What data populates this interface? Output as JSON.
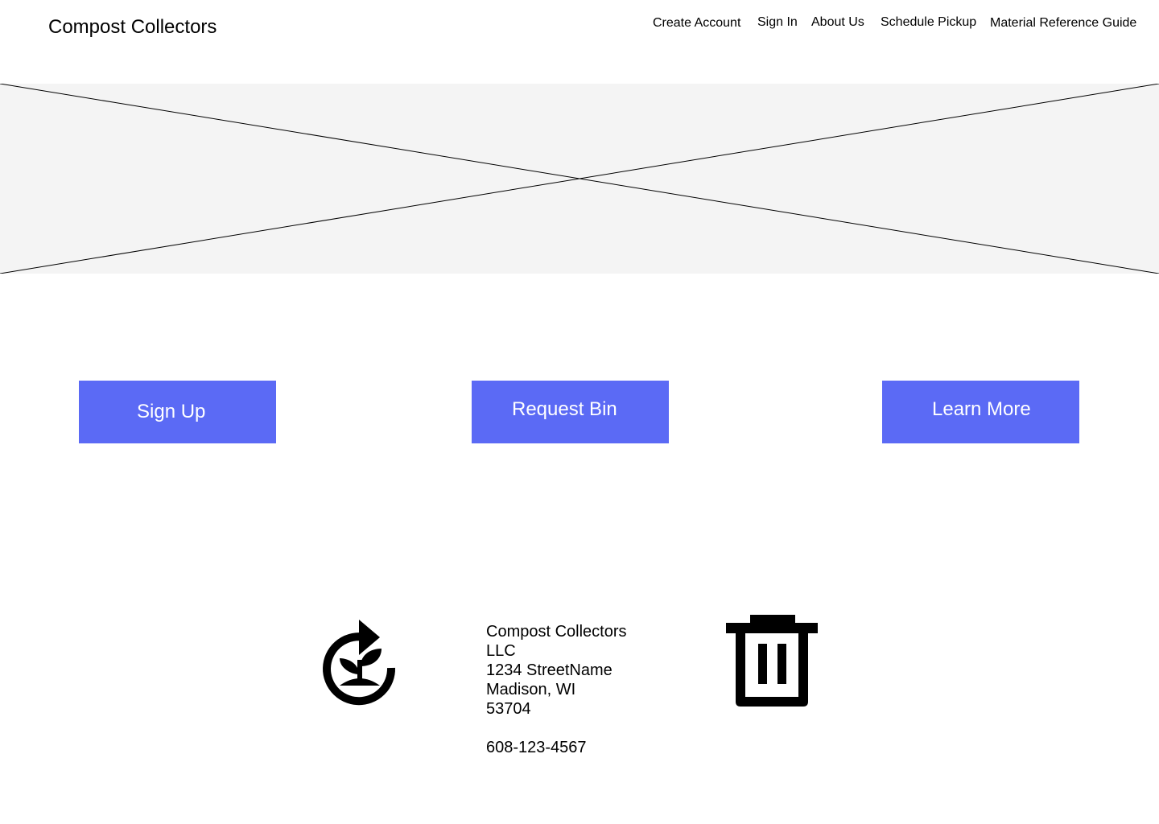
{
  "header": {
    "brand": "Compost Collectors",
    "nav": {
      "create_account": "Create Account",
      "sign_in": "Sign In",
      "about_us": "About Us",
      "schedule_pickup": "Schedule Pickup",
      "material_reference_guide": "Material Reference Guide"
    }
  },
  "hero": {
    "icon": "image-placeholder"
  },
  "actions": {
    "sign_up": "Sign Up",
    "request_bin": "Request Bin",
    "learn_more": "Learn More"
  },
  "footer": {
    "logo_icon": "plant-recycle-icon",
    "address": {
      "line1": "Compost Collectors",
      "line2": "LLC",
      "line3": "1234 StreetName",
      "line4": "Madison, WI",
      "line5": "53704"
    },
    "phone": "608-123-4567",
    "trash_icon": "trash-bin-icon"
  },
  "colors": {
    "button_bg": "#5b6af5",
    "button_text": "#ffffff",
    "hero_bg": "#f4f4f4"
  }
}
